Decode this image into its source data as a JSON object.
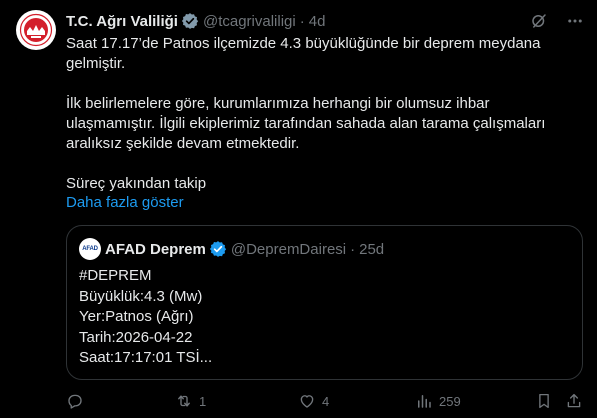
{
  "author": {
    "name": "T.C. Ağrı Valiliği",
    "handle": "@tcagrivaliligi",
    "time": "4d"
  },
  "post": {
    "paragraphs": [
      "Saat 17.17’de Patnos ilçemizde 4.3 büyüklüğünde bir deprem meydana gelmiştir.",
      "İlk belirlemelere göre, kurumlarımıza herhangi bir olumsuz ihbar ulaşmamıştır. İlgili ekiplerimiz tarafından sahada alan tarama çalışmaları aralıksız şekilde devam etmektedir.",
      "Süreç yakından takip"
    ],
    "show_more": "Daha fazla göster"
  },
  "quote": {
    "avatar_text": "AFAD",
    "name": "AFAD Deprem",
    "handle": "@DepremDairesi",
    "time": "25d",
    "lines": [
      "#DEPREM",
      "Büyüklük:4.3 (Mw)",
      "Yer:Patnos (Ağrı)",
      "Tarih:2026-04-22",
      "Saat:17:17:01 TSİ..."
    ]
  },
  "actions": {
    "replies": "",
    "reposts": "1",
    "likes": "4",
    "views": "259"
  },
  "colors": {
    "background": "#000000",
    "text": "#e7e9ea",
    "muted": "#71767b",
    "link": "#1d9bf0",
    "verified_badge": "#1d9bf0",
    "border": "#2f3336"
  }
}
